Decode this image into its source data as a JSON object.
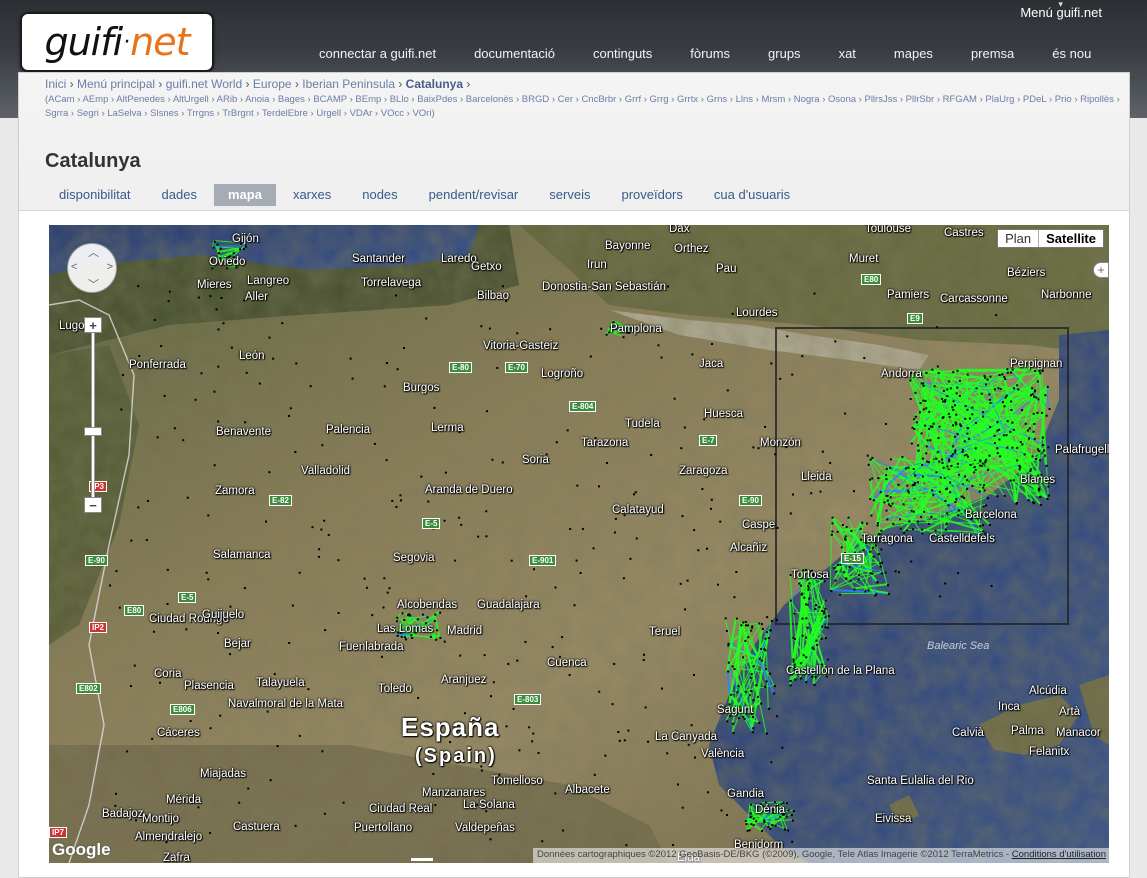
{
  "header": {
    "logo_left": "guifi",
    "logo_dot": "·",
    "logo_right": "net",
    "menu_label": "Menú guifi.net",
    "nav": [
      "connectar a guifi.net",
      "documentació",
      "continguts",
      "fòrums",
      "grups",
      "xat",
      "mapes",
      "premsa",
      "és nou"
    ]
  },
  "breadcrumb": {
    "items": [
      "Inici",
      "Menú principal",
      "guifi.net World",
      "Europe",
      "Iberian Peninsula"
    ],
    "current": "Catalunya",
    "separator": "›"
  },
  "subzones": [
    "ACam",
    "AEmp",
    "AltPenedes",
    "AltUrgell",
    "ARib",
    "Anoia",
    "Bages",
    "BCAMP",
    "BEmp",
    "BLlo",
    "BaixPdes",
    "Barcelonès",
    "BRGD",
    "Cer",
    "CncBrbr",
    "Grrf",
    "Grrg",
    "Grrtx",
    "Grns",
    "Llns",
    "Mrsm",
    "Nogra",
    "Osona",
    "PllrsJss",
    "PllrSbr",
    "RFGAM",
    "PlaUrg",
    "PDeL",
    "Prio",
    "Ripollès",
    "Sgrra",
    "Segri",
    "LaSelva",
    "Slsnes",
    "Trrgns",
    "TrBrgnt",
    "TerdelEbre",
    "Urgell",
    "VDAr",
    "VOcc",
    "VOri"
  ],
  "page_title": "Catalunya",
  "tabs": {
    "items": [
      "disponibilitat",
      "dades",
      "mapa",
      "xarxes",
      "nodes",
      "pendent/revisar",
      "serveis",
      "proveïdors",
      "cua d'usuaris"
    ],
    "active": "mapa"
  },
  "map": {
    "type_plan": "Plan",
    "type_satellite": "Satellite",
    "active_type": "Satellite",
    "zoom_in": "+",
    "zoom_out": "−",
    "expand": "+",
    "google": "Google",
    "attribution": "Données cartographiques ©2012 GeoBasis-DE/BKG (©2009), Google, Tele Atlas Imagerie ©2012 TerraMetrics -",
    "terms_link": "Conditions d'utilisation",
    "country_label": "España",
    "country_sub": "(Spain)",
    "sea_label": "Balearic Sea",
    "places": [
      "Gijón",
      "Oviedo",
      "Santander",
      "Laredo",
      "Getxo",
      "Bilbao",
      "Bayonne",
      "Orthez",
      "Dax",
      "Toulouse",
      "Castres",
      "Béziers",
      "Narbonne",
      "Carcassonne",
      "Pamiers",
      "Muret",
      "Pau",
      "Lourdes",
      "Donostia-San Sebastián",
      "Irun",
      "Torrelavega",
      "Mieres",
      "Langreo",
      "Aller",
      "Lugo",
      "Ponferrada",
      "León",
      "Vitoria-Gasteiz",
      "Logroño",
      "Pamplona",
      "Jaca",
      "Andorra",
      "Perpignan",
      "Burgos",
      "Huesca",
      "Tudela",
      "Tarazona",
      "Monzón",
      "Lleida",
      "Palafrugell",
      "Blanes",
      "Barcelona",
      "Castelldefels",
      "Tarragona",
      "Tortosa",
      "Valladolid",
      "Palencia",
      "Benavente",
      "Soria",
      "Lerma",
      "Zaragoza",
      "Zamora",
      "Aranda de Duero",
      "Calatayud",
      "Caspe",
      "Alcañiz",
      "Salamanca",
      "Segovia",
      "Alcobendas",
      "Guadalajara",
      "Madrid",
      "Las Lomas",
      "Fuenlabrada",
      "Ciudad Rodrigo",
      "Guijuelo",
      "Teruel",
      "Cuenca",
      "Aranjuez",
      "Toledo",
      "Plasencia",
      "Talayuela",
      "Coria",
      "Bejar",
      "Navalmoral de la Mata",
      "Cáceres",
      "Castellón de la Plana",
      "Sagunt",
      "València",
      "Gandia",
      "Dénia",
      "Benidorm",
      "La Canyada",
      "Elda",
      "Tomelloso",
      "Manzanares",
      "Albacete",
      "Ciudad Real",
      "La Solana",
      "Valdepeñas",
      "Puertollano",
      "Badajoz",
      "Mérida",
      "Montijo",
      "Almendralejo",
      "Zafra",
      "Castuera",
      "Miajadas",
      "Alcúdia",
      "Inca",
      "Artà",
      "Calvià",
      "Palma",
      "Manacor",
      "Felanitx",
      "Santa Eulalia del Rio",
      "Eivissa",
      "Mieres"
    ],
    "roads": [
      "E-70",
      "E80",
      "E9",
      "E-80",
      "E-804",
      "E-7",
      "E-82",
      "E-90",
      "E-5",
      "E-15",
      "E-901",
      "E-803",
      "E806",
      "E802",
      "E80",
      "E-5",
      "IP3",
      "IP2",
      "IP7",
      "E-90"
    ],
    "colors": {
      "network_green": "#22ff22",
      "network_blue": "#2288ff",
      "nodes_black": "#000000",
      "sea": "#2a3f78",
      "land_dry": "#8a7d5a",
      "land_green": "#505a35"
    }
  }
}
